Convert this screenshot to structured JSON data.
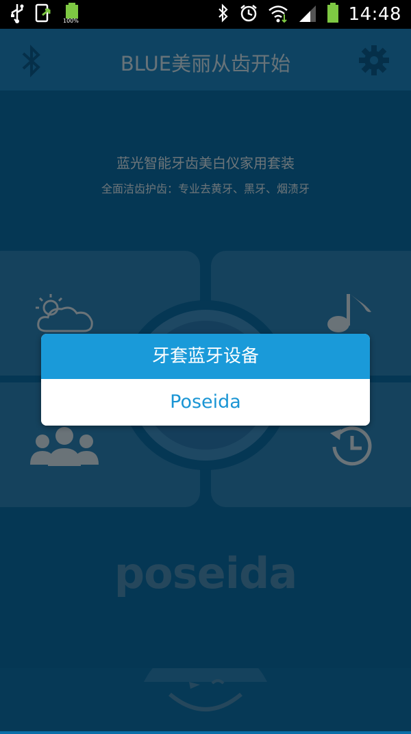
{
  "status_bar": {
    "time": "14:48",
    "battery_small_label": "100%",
    "icons_left": [
      "usb-icon",
      "screenshot-icon",
      "battery-full-icon"
    ],
    "icons_right": [
      "bluetooth-icon",
      "alarm-icon",
      "wifi-icon",
      "signal-icon",
      "battery-icon"
    ]
  },
  "app_bar": {
    "title": "BLUE美丽从齿开始",
    "left_icon": "bluetooth-icon",
    "right_icon": "gear-icon"
  },
  "hero": {
    "title": "蓝光智能牙齿美白仪家用套装",
    "subtitle": "全面洁齿护齿：专业去黄牙、黑牙、烟渍牙"
  },
  "tiles": [
    {
      "icon": "weather-icon"
    },
    {
      "icon": "music-note-icon"
    },
    {
      "icon": "users-icon"
    },
    {
      "icon": "clock-history-icon"
    }
  ],
  "logo": "poseida",
  "dialog": {
    "title": "牙套蓝牙设备",
    "items": [
      "Poseida"
    ]
  },
  "colors": {
    "background": "#0a6ea8",
    "appbar": "#1c86c4",
    "tile": "#2b84bb",
    "dialog_header": "#1a9ad9",
    "dialog_item_text": "#1a95d4"
  }
}
